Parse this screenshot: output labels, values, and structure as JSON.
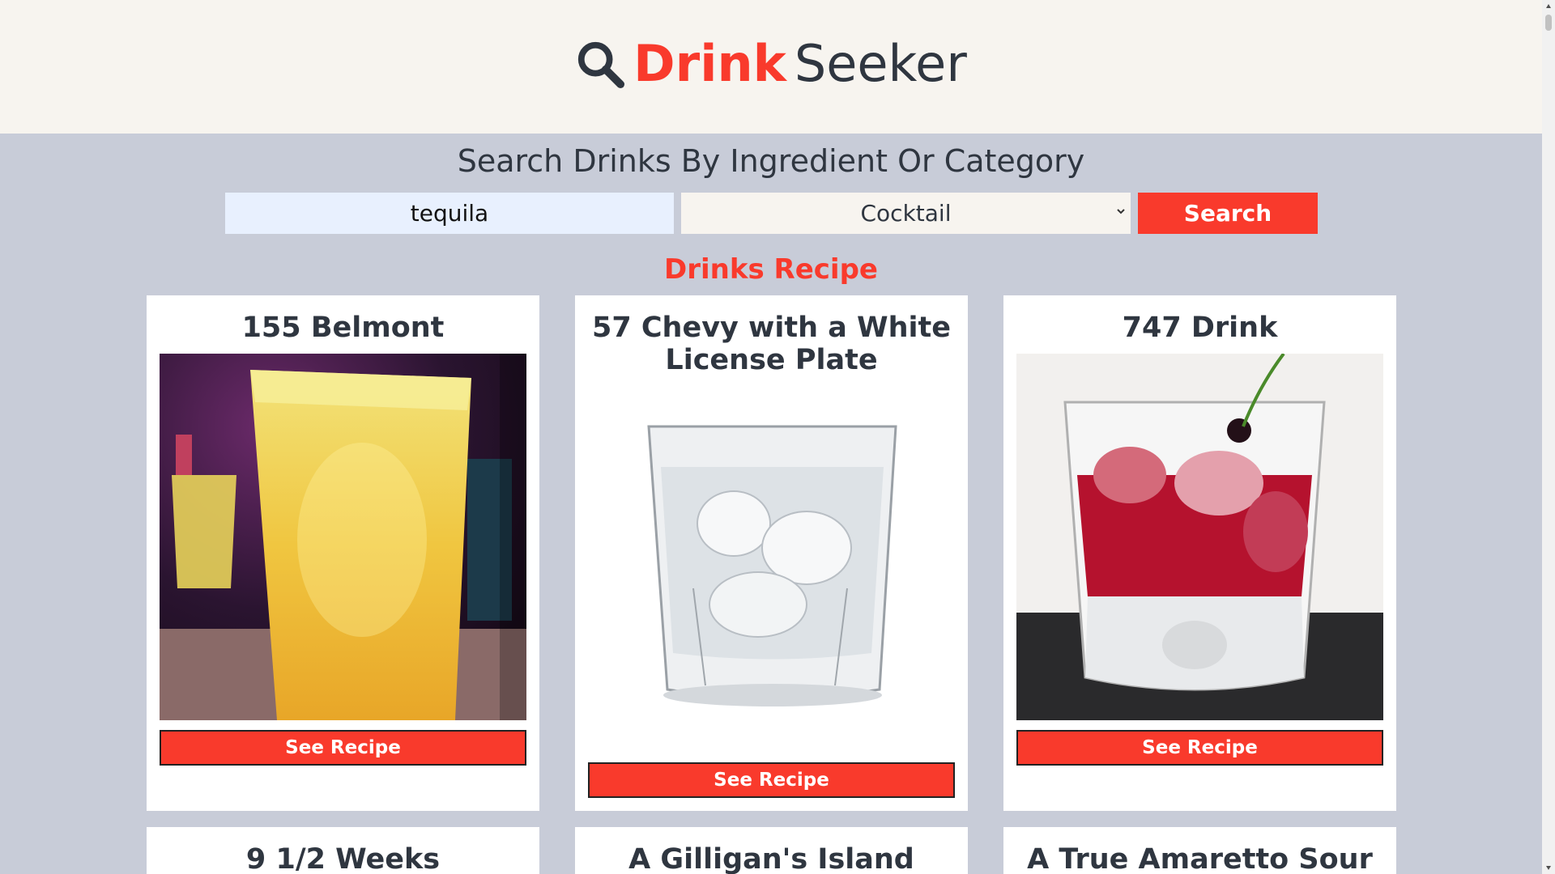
{
  "header": {
    "brand_word1": "Drink",
    "brand_word2": "Seeker",
    "icon": "search-icon",
    "background": "#f7f4ef",
    "accent": "#f93a2c"
  },
  "search": {
    "heading": "Search Drinks By Ingredient Or Category",
    "input_value": "tequila",
    "category_selected": "Cocktail",
    "button_label": "Search"
  },
  "results": {
    "title": "Drinks Recipe",
    "cards": [
      {
        "title": "155 Belmont",
        "button_label": "See Recipe",
        "image": "orange-cocktail-photo"
      },
      {
        "title": "57 Chevy with a White License Plate",
        "button_label": "See Recipe",
        "image": "clear-drink-glass-photo"
      },
      {
        "title": "747 Drink",
        "button_label": "See Recipe",
        "image": "red-cocktail-photo"
      },
      {
        "title": "9 1/2 Weeks"
      },
      {
        "title": "A Gilligan's Island"
      },
      {
        "title": "A True Amaretto Sour"
      }
    ]
  },
  "colors": {
    "page_background": "#c8ccd8",
    "button": "#f93a2c",
    "text_dark": "#2f3640"
  }
}
